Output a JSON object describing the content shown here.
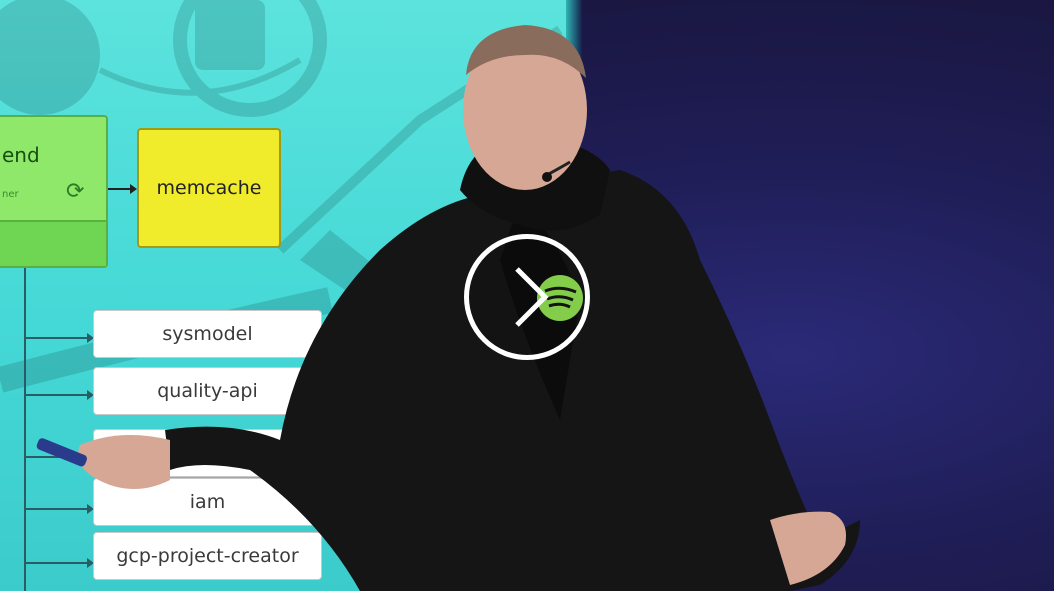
{
  "slide": {
    "backend_label": "end",
    "memcache_label": "memcache",
    "services": [
      "sysmodel",
      "quality-api",
      "iam",
      "gcp-project-creator"
    ]
  },
  "player": {
    "play_icon": "chevron-right-icon"
  },
  "colors": {
    "slide_bg": "#47dbd8",
    "memcache_fill": "#f1ec2b",
    "backend_fill": "#8fe86a",
    "stage_bg": "#1f1d55",
    "hoodie": "#151515",
    "logo_green": "#8bd94e"
  }
}
